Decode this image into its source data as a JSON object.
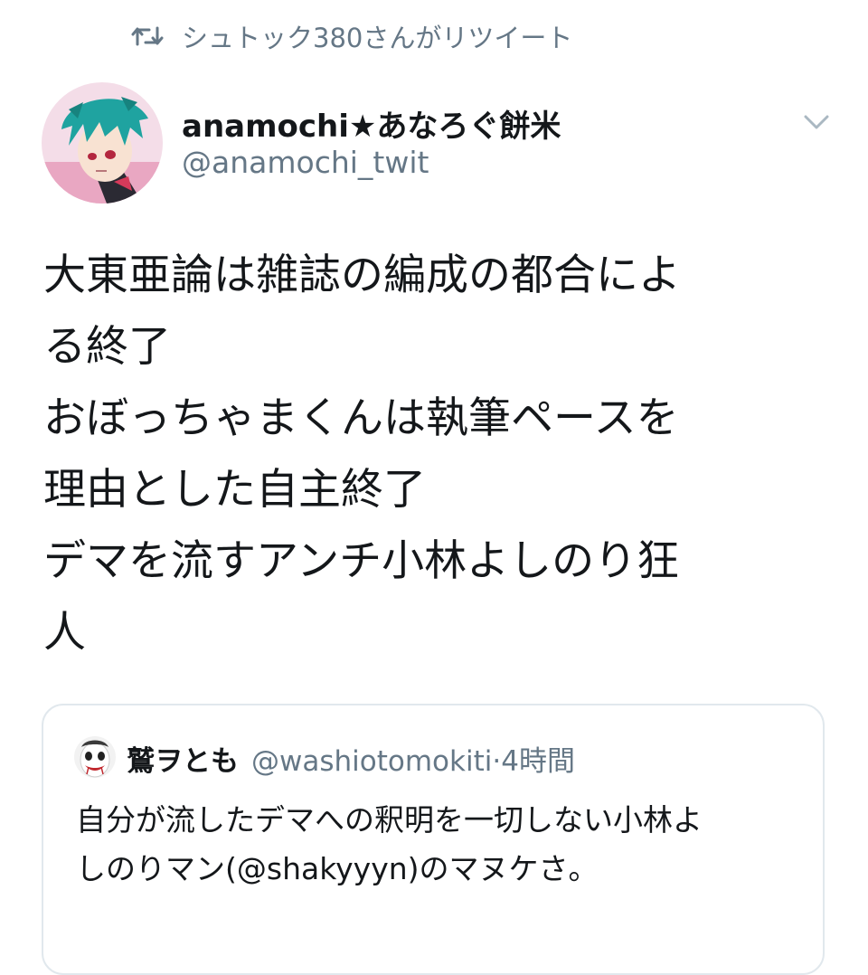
{
  "retweet": {
    "icon": "retweet-icon",
    "text": "シュトック380さんがリツイート"
  },
  "tweet": {
    "author": {
      "display_name": "anamochi★あなろぐ餅米",
      "handle": "@anamochi_twit",
      "avatar": "avatar-anime-character"
    },
    "menu_icon": "chevron-down-icon",
    "text_lines": [
      "大東亜論は雑誌の編成の都合によ",
      "る終了",
      "おぼっちゃまくんは執筆ペースを",
      "理由とした自主終了",
      "デマを流すアンチ小林よしのり狂",
      "人"
    ]
  },
  "quoted_tweet": {
    "avatar": "avatar-clown-face",
    "display_name": "鷲ヲとも",
    "handle": "@washiotomokiti",
    "separator": "·",
    "time": "4時間",
    "text_lines": [
      "自分が流したデマへの釈明を一切しない小林よ",
      "しのりマン(@shakyyyn)のマヌケさ。"
    ]
  },
  "colors": {
    "text_primary": "#14171a",
    "text_secondary": "#657786",
    "border": "#e1e8ed",
    "background": "#ffffff"
  }
}
